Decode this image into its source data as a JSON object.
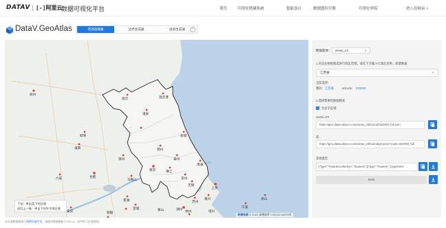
{
  "topnav": {
    "logo_datav": "DATAV",
    "logo_aliyun_bracket": "[-]",
    "logo_aliyun_text": "阿里云",
    "title": "数据可视化平台",
    "items": [
      "首页",
      "可视化搭建系统",
      "智能设计",
      "数据图形引擎",
      "可视化学院",
      "进入控制台 >"
    ]
  },
  "header": {
    "brand": "DataV.GeoAtlas",
    "tabs": [
      "范围选择器",
      "边界生成器",
      "层级生成器"
    ],
    "active_tab": 0,
    "help": "?"
  },
  "map": {
    "labels": {
      "city_hefei": "合肥",
      "city_nanjing": "南京",
      "city_shanghai": "上海",
      "city_hangzhou": "杭州",
      "city_xuzhou": "徐州",
      "city_lianyungang": "连云港",
      "city_yancheng": "盐城",
      "city_nantong": "南通",
      "city_suzhou": "苏州",
      "city_huaian": "淮安",
      "city_yangzhou": "扬州",
      "city_zhenjiang": "镇江",
      "city_taizhou": "泰州",
      "city_wuxi": "无锡",
      "city_changzhou": "常州",
      "city_suqian": "宿迁",
      "city_wuhu": "芜湖",
      "city_ningbo": "宁波",
      "city_bengbu": "蚌埠",
      "city_huzhou": "湖州",
      "city_jiaxing": "嘉兴",
      "city_maanshan": "马鞍山",
      "city_huainan": "淮南",
      "city_chuzhou": "滁州",
      "city_liuan": "六安",
      "city_anqing": "安庆",
      "city_tongling": "铜陵",
      "city_xuancheng": "宣城",
      "city_huangshan": "黄山",
      "city_shaoxing": "绍兴",
      "city_zhoushan": "舟山"
    },
    "hint_line1": "下钻：单击蓝下钻区域",
    "hint_line2": "返回上一级：单击下钻外空地区域",
    "attribution_brand": "高德地图",
    "attribution_text": "© 2022 高德软件 GS(2021)6375号"
  },
  "footer": {
    "prefix": "本页面数据来源于",
    "link": "高德开放平台",
    "suffix": "，该版本数据更新于2021.5，仅供学习交流使用。"
  },
  "panel": {
    "version_label": "数据版本：",
    "version_value": "areas_v3",
    "step1": "1.点击左侧地图选择行政区范围，或在下方输入行政区名称，获取数据",
    "region_value": "江苏省",
    "current_label": "当前选择：",
    "breadcrumb_root": "我的：",
    "breadcrumb_region": "江苏省",
    "adcode_label": "adcode:",
    "adcode_value": "320000",
    "step2": "2.选择需要的数据格式",
    "include_sub": "包含子区域",
    "json_api_label": "JSON API",
    "json_api_url": "https://geo.datav.aliyun.com/areas_v3/bound/320000_full.json",
    "or_label": "或",
    "geojson_url": "https://geo.datav.aliyun.com/areas_v3/bound/geojson?code=320000_full",
    "other_label": "其他类型",
    "code_preview": "{\"type\":\"FeatureCollection\",\"features\":[{\"type\":\"Feature\",\"properties\"",
    "svg_button": "SVG"
  },
  "colors": {
    "accent": "#1f7ae0",
    "map_bg": "#eef0ec",
    "sea": "#bcd2e8",
    "highlight": "#f5f5f3",
    "boundary": "#222222"
  }
}
